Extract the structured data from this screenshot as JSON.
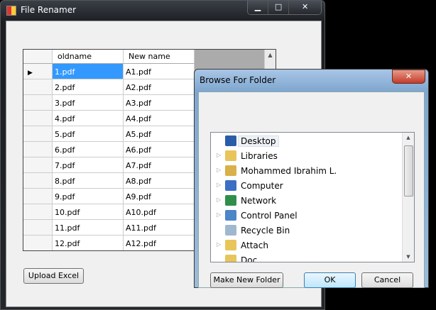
{
  "main": {
    "title": "File Renamer",
    "min": "▁",
    "max": "□",
    "close": "✕",
    "grid": {
      "columns": [
        "oldname",
        "New name"
      ],
      "rows": [
        [
          "1.pdf",
          "A1.pdf"
        ],
        [
          "2.pdf",
          "A2.pdf"
        ],
        [
          "3.pdf",
          "A3.pdf"
        ],
        [
          "4.pdf",
          "A4.pdf"
        ],
        [
          "5.pdf",
          "A5.pdf"
        ],
        [
          "6.pdf",
          "A6.pdf"
        ],
        [
          "7.pdf",
          "A7.pdf"
        ],
        [
          "8.pdf",
          "A8.pdf"
        ],
        [
          "9.pdf",
          "A9.pdf"
        ],
        [
          "10.pdf",
          "A10.pdf"
        ],
        [
          "11.pdf",
          "A11.pdf"
        ],
        [
          "12.pdf",
          "A12.pdf"
        ]
      ],
      "current_row_marker": "▶"
    },
    "upload_button": "Upload Excel"
  },
  "dialog": {
    "title": "Browse For Folder",
    "close": "✕",
    "tree": [
      {
        "label": "Desktop",
        "icon": "desktop-icon",
        "expander": false,
        "color": "#2a5da8",
        "selected": true
      },
      {
        "label": "Libraries",
        "icon": "libraries-icon",
        "expander": true,
        "color": "#e8c55a"
      },
      {
        "label": "Mohammed Ibrahim L.",
        "icon": "user-folder-icon",
        "expander": true,
        "color": "#d9b04a"
      },
      {
        "label": "Computer",
        "icon": "computer-icon",
        "expander": true,
        "color": "#3a6fc4"
      },
      {
        "label": "Network",
        "icon": "network-icon",
        "expander": true,
        "color": "#2f8f4a"
      },
      {
        "label": "Control Panel",
        "icon": "control-panel-icon",
        "expander": true,
        "color": "#4a86c8"
      },
      {
        "label": "Recycle Bin",
        "icon": "recycle-bin-icon",
        "expander": false,
        "color": "#9fb8d0"
      },
      {
        "label": "Attach",
        "icon": "folder-icon",
        "expander": true,
        "color": "#e8c55a"
      },
      {
        "label": "Doc",
        "icon": "folder-icon",
        "expander": false,
        "color": "#e8c55a"
      }
    ],
    "make_new_folder": "Make New Folder",
    "ok": "OK",
    "cancel": "Cancel"
  }
}
